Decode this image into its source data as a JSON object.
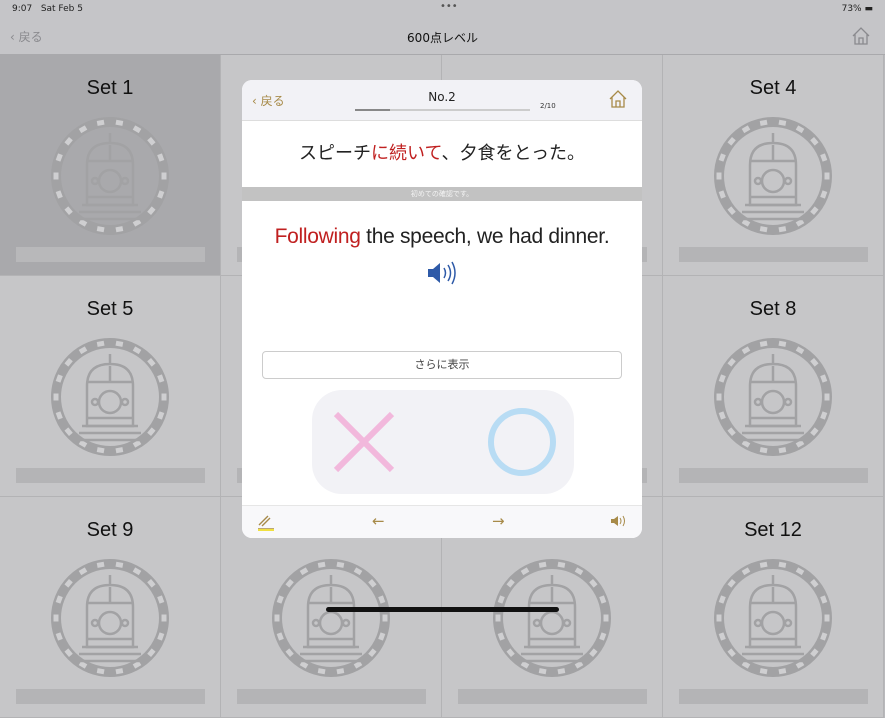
{
  "status": {
    "time": "9:07",
    "date": "Sat Feb 5",
    "battery": "73%",
    "dots": "•••"
  },
  "nav": {
    "back": "戻る",
    "title": "600点レベル",
    "home_icon": "home-icon"
  },
  "sets": [
    {
      "name": "Set 1",
      "selected": true
    },
    {
      "name": ""
    },
    {
      "name": ""
    },
    {
      "name": "Set 4"
    },
    {
      "name": "Set 5"
    },
    {
      "name": ""
    },
    {
      "name": ""
    },
    {
      "name": "Set 8"
    },
    {
      "name": "Set 9"
    },
    {
      "name": ""
    },
    {
      "name": ""
    },
    {
      "name": "Set 12"
    }
  ],
  "modal": {
    "back": "戻る",
    "number": "No.2",
    "counter": "2/10",
    "progress": 0.2,
    "jp_pre": "スピーチ",
    "jp_hl": "に続いて",
    "jp_post": "、夕食をとった。",
    "note": "初めての確認です。",
    "en_hl": "Following",
    "en_rest": " the speech, we had dinner.",
    "more": "さらに表示",
    "footer": {
      "prev": "←",
      "next": "→"
    }
  },
  "colors": {
    "highlight": "#c02020",
    "accent": "#a78a48",
    "wrong": "#f2b8dc",
    "correct": "#b8dcf4",
    "speaker": "#2e5aa8"
  }
}
